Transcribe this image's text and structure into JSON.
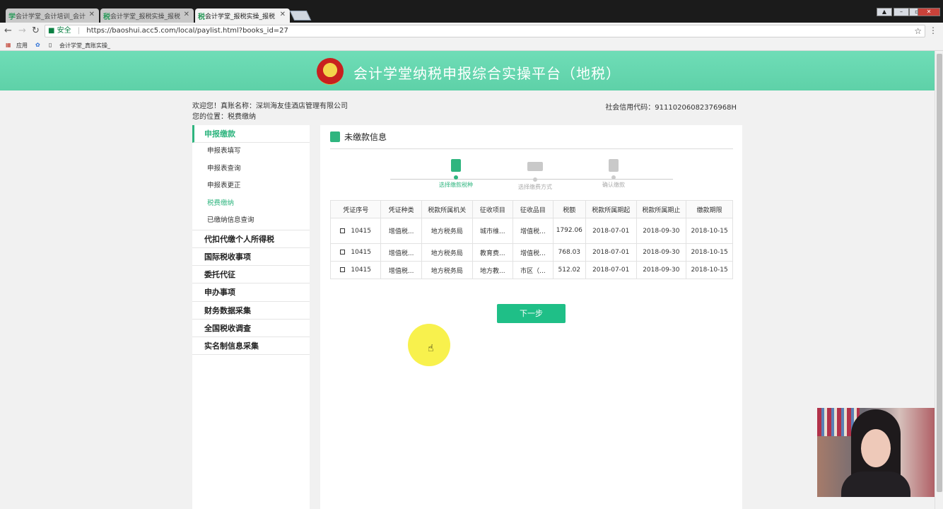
{
  "browser": {
    "tabs": [
      {
        "icon": "学",
        "label": "会计学堂_会计培训_会计"
      },
      {
        "icon": "税",
        "label": "会计学堂_报税实操_报税"
      },
      {
        "icon": "税",
        "label": "会计学堂_报税实操_报税"
      }
    ],
    "secure_label": "安全",
    "url": "https://baoshui.acc5.com/local/paylist.html?books_id=27",
    "bookmarks": [
      "应用",
      "会计学堂_真账实操_"
    ]
  },
  "header": {
    "title": "会计学堂纳税申报综合实操平台（地税）"
  },
  "info": {
    "welcome": "欢迎您！真账名称：深圳海友佳酒店管理有限公司",
    "location": "您的位置：税费缴纳",
    "credit_code": "社会信用代码：91110206082376968H"
  },
  "sidebar": {
    "section": "申报缴款",
    "subitems": [
      "申报表填写",
      "申报表查询",
      "申报表更正",
      "税费缴纳",
      "已缴纳信息查询"
    ],
    "active_subitem": "税费缴纳",
    "groups": [
      "代扣代缴个人所得税",
      "国际税收事项",
      "委托代征",
      "申办事项",
      "财务数据采集",
      "全国税收调查",
      "实名制信息采集"
    ]
  },
  "main": {
    "title": "未缴款信息",
    "steps": [
      "选择缴款税种",
      "选择缴费方式",
      "确认缴款"
    ],
    "active_step": 0,
    "columns": [
      "凭证序号",
      "凭证种类",
      "税款所属机关",
      "征收项目",
      "征收品目",
      "税额",
      "税款所属期起",
      "税款所属期止",
      "缴款期限"
    ],
    "rows": [
      [
        "10415",
        "增值税...",
        "地方税务局",
        "城市维...",
        "增值税...",
        "1792.06",
        "2018-07-01",
        "2018-09-30",
        "2018-10-15"
      ],
      [
        "10415",
        "增值税...",
        "地方税务局",
        "教育费...",
        "增值税...",
        "768.03",
        "2018-07-01",
        "2018-09-30",
        "2018-10-15"
      ],
      [
        "10415",
        "增值税...",
        "地方税务局",
        "地方教...",
        "市区（...",
        "512.02",
        "2018-07-01",
        "2018-09-30",
        "2018-10-15"
      ]
    ],
    "next_label": "下一步"
  },
  "colors": {
    "brand": "#2fb57f",
    "header": "#6fddb7",
    "button": "#1fbf87"
  }
}
